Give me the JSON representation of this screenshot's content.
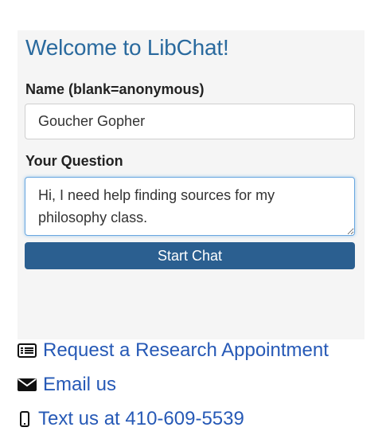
{
  "chat": {
    "title": "Welcome to LibChat!",
    "name_label": "Name (blank=anonymous)",
    "name_value": "Goucher Gopher",
    "question_label": "Your Question",
    "question_value": "Hi, I need help finding sources for my philosophy class.",
    "start_button": "Start Chat"
  },
  "links": {
    "appointment": {
      "label": "Request a Research Appointment",
      "icon": "newspaper-icon"
    },
    "email": {
      "label": "Email us",
      "icon": "envelope-icon"
    },
    "text": {
      "label": "Text us at 410-609-5539",
      "icon": "mobile-phone-icon"
    }
  },
  "colors": {
    "title": "#2a6a9e",
    "button": "#2b5f90",
    "link": "#2659b6",
    "panel": "#f5f5f5"
  }
}
